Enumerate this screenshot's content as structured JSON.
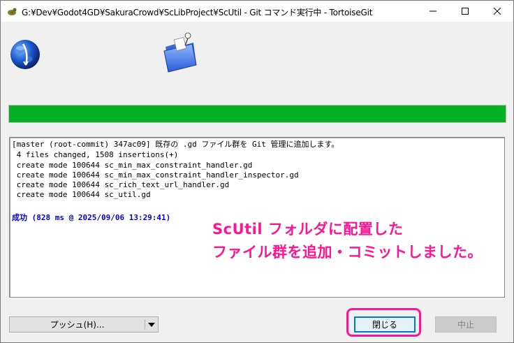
{
  "window": {
    "title": "G:¥Dev¥Godot4GD¥SakuraCrowd¥ScLibProject¥ScUtil - Git コマンド実行中 - TortoiseGit",
    "minimize_label": "—",
    "maximize_label": "☐",
    "close_label": "✕"
  },
  "progress": {
    "fraction": 1.0,
    "color": "#06b025"
  },
  "log": {
    "lines": [
      "[master (root-commit) 347ac09] 既存の .gd ファイル群を Git 管理に追加します。",
      " 4 files changed, 1508 insertions(+)",
      " create mode 100644 sc_min_max_constraint_handler.gd",
      " create mode 100644 sc_min_max_constraint_handler_inspector.gd",
      " create mode 100644 sc_rich_text_url_handler.gd",
      " create mode 100644 sc_util.gd"
    ],
    "success": "成功 (828 ms @ 2025/09/06 13:29:41)",
    "success_color": "#0000d0"
  },
  "annotation": {
    "line1": "ScUtil フォルダに配置した",
    "line2": "ファイル群を追加・コミットしました。",
    "color": "#ff1493"
  },
  "buttons": {
    "push": "プッシュ(H)...",
    "push_dropdown_icon": "dropdown-arrow",
    "close": "閉じる",
    "stop": "中止"
  },
  "icons": {
    "title": "tortoisegit-icon",
    "banner_left": "globe-icon",
    "banner_right": "folder-icon"
  }
}
